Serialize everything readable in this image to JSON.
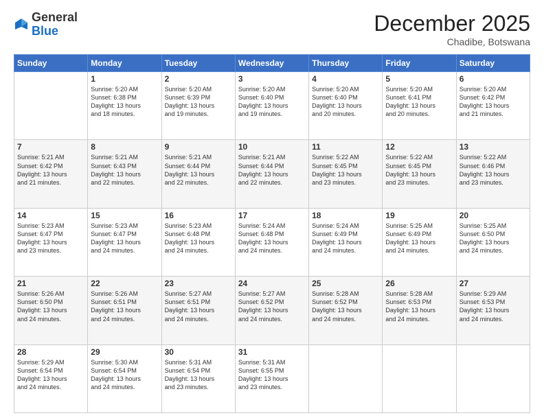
{
  "header": {
    "logo_general": "General",
    "logo_blue": "Blue",
    "month_title": "December 2025",
    "location": "Chadibe, Botswana"
  },
  "weekdays": [
    "Sunday",
    "Monday",
    "Tuesday",
    "Wednesday",
    "Thursday",
    "Friday",
    "Saturday"
  ],
  "weeks": [
    [
      {
        "day": "",
        "info": ""
      },
      {
        "day": "1",
        "info": "Sunrise: 5:20 AM\nSunset: 6:38 PM\nDaylight: 13 hours\nand 18 minutes."
      },
      {
        "day": "2",
        "info": "Sunrise: 5:20 AM\nSunset: 6:39 PM\nDaylight: 13 hours\nand 19 minutes."
      },
      {
        "day": "3",
        "info": "Sunrise: 5:20 AM\nSunset: 6:40 PM\nDaylight: 13 hours\nand 19 minutes."
      },
      {
        "day": "4",
        "info": "Sunrise: 5:20 AM\nSunset: 6:40 PM\nDaylight: 13 hours\nand 20 minutes."
      },
      {
        "day": "5",
        "info": "Sunrise: 5:20 AM\nSunset: 6:41 PM\nDaylight: 13 hours\nand 20 minutes."
      },
      {
        "day": "6",
        "info": "Sunrise: 5:20 AM\nSunset: 6:42 PM\nDaylight: 13 hours\nand 21 minutes."
      }
    ],
    [
      {
        "day": "7",
        "info": "Sunrise: 5:21 AM\nSunset: 6:42 PM\nDaylight: 13 hours\nand 21 minutes."
      },
      {
        "day": "8",
        "info": "Sunrise: 5:21 AM\nSunset: 6:43 PM\nDaylight: 13 hours\nand 22 minutes."
      },
      {
        "day": "9",
        "info": "Sunrise: 5:21 AM\nSunset: 6:44 PM\nDaylight: 13 hours\nand 22 minutes."
      },
      {
        "day": "10",
        "info": "Sunrise: 5:21 AM\nSunset: 6:44 PM\nDaylight: 13 hours\nand 22 minutes."
      },
      {
        "day": "11",
        "info": "Sunrise: 5:22 AM\nSunset: 6:45 PM\nDaylight: 13 hours\nand 23 minutes."
      },
      {
        "day": "12",
        "info": "Sunrise: 5:22 AM\nSunset: 6:45 PM\nDaylight: 13 hours\nand 23 minutes."
      },
      {
        "day": "13",
        "info": "Sunrise: 5:22 AM\nSunset: 6:46 PM\nDaylight: 13 hours\nand 23 minutes."
      }
    ],
    [
      {
        "day": "14",
        "info": "Sunrise: 5:23 AM\nSunset: 6:47 PM\nDaylight: 13 hours\nand 23 minutes."
      },
      {
        "day": "15",
        "info": "Sunrise: 5:23 AM\nSunset: 6:47 PM\nDaylight: 13 hours\nand 24 minutes."
      },
      {
        "day": "16",
        "info": "Sunrise: 5:23 AM\nSunset: 6:48 PM\nDaylight: 13 hours\nand 24 minutes."
      },
      {
        "day": "17",
        "info": "Sunrise: 5:24 AM\nSunset: 6:48 PM\nDaylight: 13 hours\nand 24 minutes."
      },
      {
        "day": "18",
        "info": "Sunrise: 5:24 AM\nSunset: 6:49 PM\nDaylight: 13 hours\nand 24 minutes."
      },
      {
        "day": "19",
        "info": "Sunrise: 5:25 AM\nSunset: 6:49 PM\nDaylight: 13 hours\nand 24 minutes."
      },
      {
        "day": "20",
        "info": "Sunrise: 5:25 AM\nSunset: 6:50 PM\nDaylight: 13 hours\nand 24 minutes."
      }
    ],
    [
      {
        "day": "21",
        "info": "Sunrise: 5:26 AM\nSunset: 6:50 PM\nDaylight: 13 hours\nand 24 minutes."
      },
      {
        "day": "22",
        "info": "Sunrise: 5:26 AM\nSunset: 6:51 PM\nDaylight: 13 hours\nand 24 minutes."
      },
      {
        "day": "23",
        "info": "Sunrise: 5:27 AM\nSunset: 6:51 PM\nDaylight: 13 hours\nand 24 minutes."
      },
      {
        "day": "24",
        "info": "Sunrise: 5:27 AM\nSunset: 6:52 PM\nDaylight: 13 hours\nand 24 minutes."
      },
      {
        "day": "25",
        "info": "Sunrise: 5:28 AM\nSunset: 6:52 PM\nDaylight: 13 hours\nand 24 minutes."
      },
      {
        "day": "26",
        "info": "Sunrise: 5:28 AM\nSunset: 6:53 PM\nDaylight: 13 hours\nand 24 minutes."
      },
      {
        "day": "27",
        "info": "Sunrise: 5:29 AM\nSunset: 6:53 PM\nDaylight: 13 hours\nand 24 minutes."
      }
    ],
    [
      {
        "day": "28",
        "info": "Sunrise: 5:29 AM\nSunset: 6:54 PM\nDaylight: 13 hours\nand 24 minutes."
      },
      {
        "day": "29",
        "info": "Sunrise: 5:30 AM\nSunset: 6:54 PM\nDaylight: 13 hours\nand 24 minutes."
      },
      {
        "day": "30",
        "info": "Sunrise: 5:31 AM\nSunset: 6:54 PM\nDaylight: 13 hours\nand 23 minutes."
      },
      {
        "day": "31",
        "info": "Sunrise: 5:31 AM\nSunset: 6:55 PM\nDaylight: 13 hours\nand 23 minutes."
      },
      {
        "day": "",
        "info": ""
      },
      {
        "day": "",
        "info": ""
      },
      {
        "day": "",
        "info": ""
      }
    ]
  ]
}
